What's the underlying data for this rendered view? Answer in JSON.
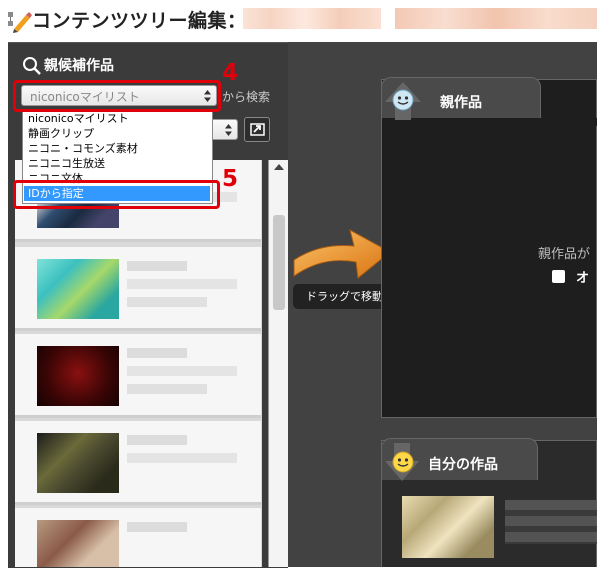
{
  "header": {
    "title": "コンテンツツリー編集："
  },
  "left_panel": {
    "title": "親候補作品",
    "source_select": {
      "value": "niconicoマイリスト"
    },
    "search_suffix": "から検索",
    "dropdown_options": [
      "niconicoマイリスト",
      "静画クリップ",
      "ニコニ・コモンズ素材",
      "ニコニコ生放送",
      "ニコニ文体",
      "IDから指定"
    ],
    "selected_option": "IDから指定"
  },
  "annotations": {
    "step4": "4",
    "step5": "5"
  },
  "drag": {
    "label": "ドラッグで移動"
  },
  "parent_panel": {
    "title": "親作品",
    "placeholder": "親作品が",
    "checkbox_label": "オ"
  },
  "own_panel": {
    "title": "自分の作品"
  },
  "colors": {
    "accent_red": "#e0000a",
    "highlight": "#3399ff",
    "arrow": "#e8921f"
  }
}
